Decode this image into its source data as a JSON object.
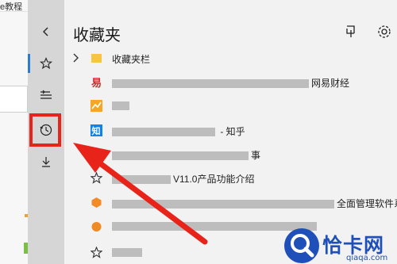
{
  "browser": {
    "top_text": "e教程"
  },
  "hub": {
    "title": "收藏夹",
    "items": [
      {
        "label": "收藏夹栏",
        "icon": "folder-icon"
      },
      {
        "label_suffix": "网易财经",
        "icon": "netease-icon"
      },
      {
        "label_suffix": "",
        "icon": "stock-icon"
      },
      {
        "label_suffix": " - 知乎",
        "icon": "zhihu-icon"
      },
      {
        "label_suffix": "事",
        "icon": "favicon-icon"
      },
      {
        "label_suffix": "V11.0产品功能介绍",
        "icon": "star-icon"
      },
      {
        "label_suffix": "全面管理软件系",
        "icon": "hexagon-icon"
      },
      {
        "label_suffix": "",
        "icon": "orange-logo-icon"
      },
      {
        "label_suffix": "",
        "icon": "star-icon"
      }
    ]
  },
  "watermark": {
    "brand": "恰卡网",
    "domain": "qiaqa.com"
  },
  "colors": {
    "accent": "#2a7bd3",
    "highlight": "#e8231a",
    "brand": "#1f4fb8"
  }
}
